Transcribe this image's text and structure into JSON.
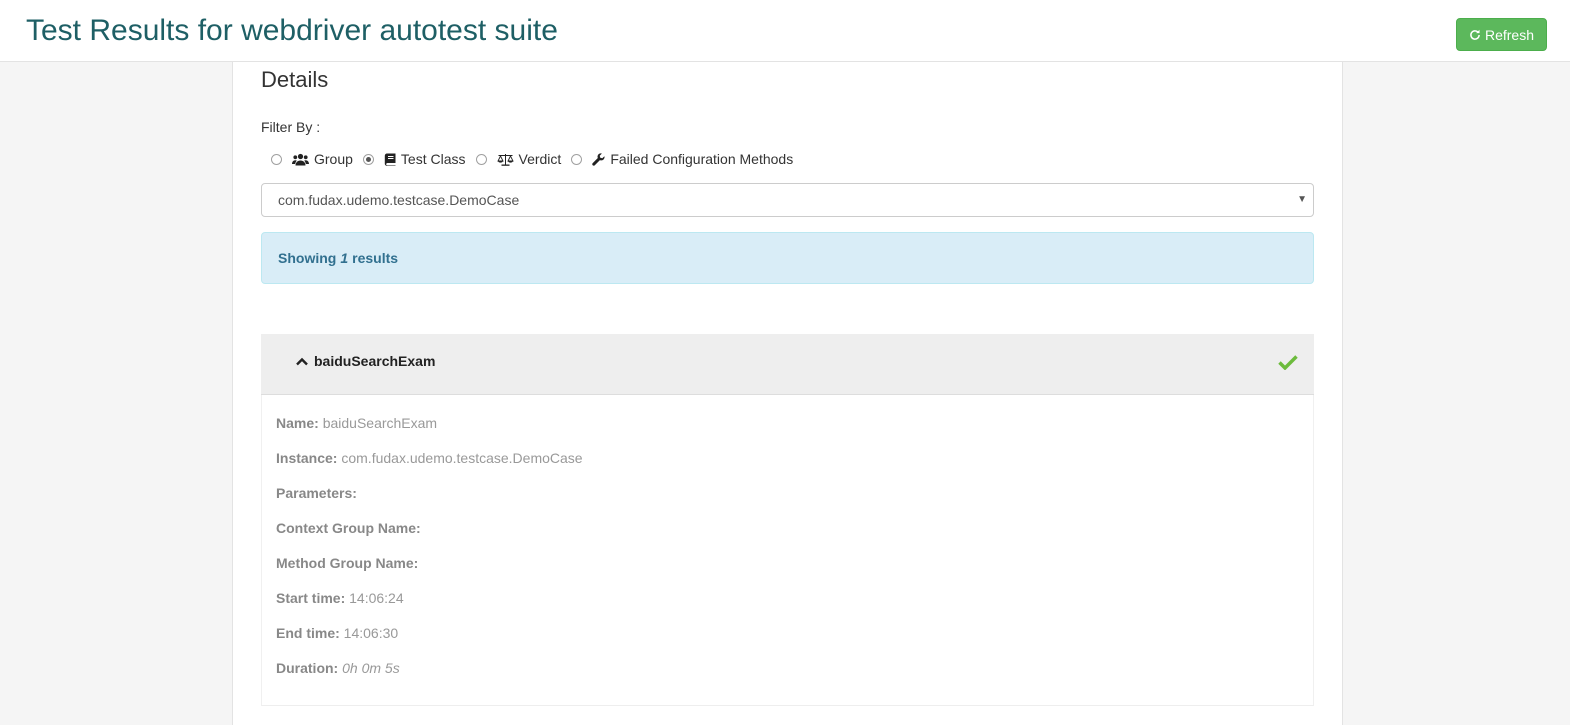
{
  "header": {
    "title": "Test Results for webdriver autotest suite",
    "refresh_label": "Refresh"
  },
  "details": {
    "title": "Details",
    "filter_label": "Filter By :",
    "filter_options": [
      {
        "label": "Group",
        "icon": "users-icon",
        "selected": false
      },
      {
        "label": "Test Class",
        "icon": "book-icon",
        "selected": true
      },
      {
        "label": "Verdict",
        "icon": "balance-scale-icon",
        "selected": false
      },
      {
        "label": "Failed Configuration Methods",
        "icon": "wrench-icon",
        "selected": false
      }
    ],
    "selected_class": "com.fudax.udemo.testcase.DemoCase",
    "showing_prefix": "Showing",
    "showing_count": "1",
    "showing_suffix": "results"
  },
  "result": {
    "method_name": "baiduSearchExam",
    "status": "passed",
    "status_color": "#5cb85c",
    "fields": [
      {
        "label": "Name:",
        "value": "baiduSearchExam",
        "italic": false
      },
      {
        "label": "Instance:",
        "value": "com.fudax.udemo.testcase.DemoCase",
        "italic": false
      },
      {
        "label": "Parameters:",
        "value": "",
        "italic": false
      },
      {
        "label": "Context Group Name:",
        "value": "",
        "italic": false
      },
      {
        "label": "Method Group Name:",
        "value": "",
        "italic": false
      },
      {
        "label": "Start time:",
        "value": "14:06:24",
        "italic": false
      },
      {
        "label": "End time:",
        "value": "14:06:30",
        "italic": false
      },
      {
        "label": "Duration:",
        "value": "0h 0m 5s",
        "italic": true
      }
    ]
  },
  "colors": {
    "title": "#1e5f65",
    "refresh_bg": "#5cb85c",
    "alert_bg": "#d9edf7",
    "alert_text": "#31708f"
  }
}
